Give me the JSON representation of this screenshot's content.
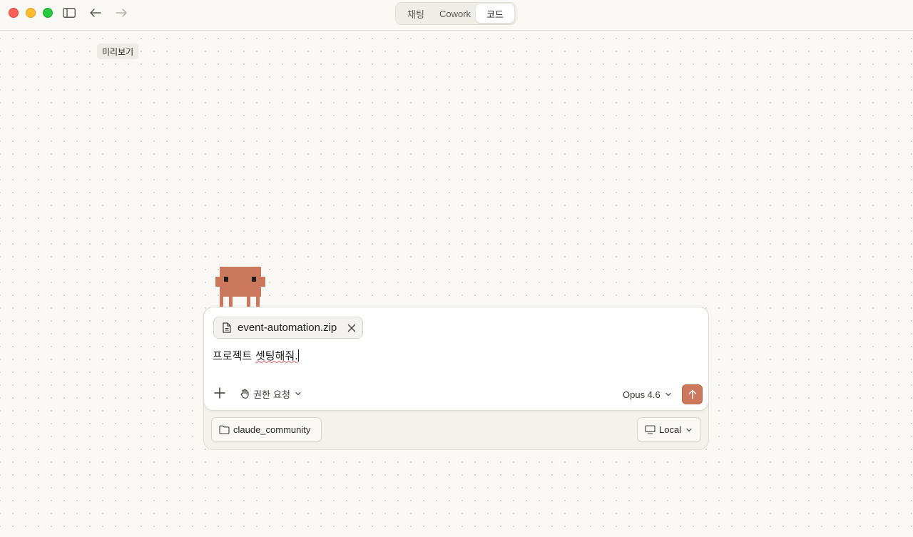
{
  "titlebar": {
    "icons": [
      "close-window",
      "minimize-window",
      "maximize-window",
      "sidebar-toggle-icon",
      "arrow-left-icon",
      "arrow-right-icon"
    ]
  },
  "mode_tabs": [
    {
      "label": "채팅"
    },
    {
      "label": "Cowork"
    },
    {
      "label": "코드",
      "selected": true
    }
  ],
  "preview": {
    "label": "미리보기"
  },
  "composer": {
    "attachment": {
      "file_name": "event-automation.zip"
    },
    "prompt_main": "프로젝트 ",
    "prompt_misspelled": "셋팅해줘.",
    "permission_label": "권한 요청",
    "model_label": "Opus 4.6"
  },
  "footer": {
    "folder_label": "claude_community",
    "environment_label": "Local"
  },
  "colors": {
    "accent": "#cc785c",
    "background": "#f9f8f5",
    "mascot": "#cc785c"
  }
}
